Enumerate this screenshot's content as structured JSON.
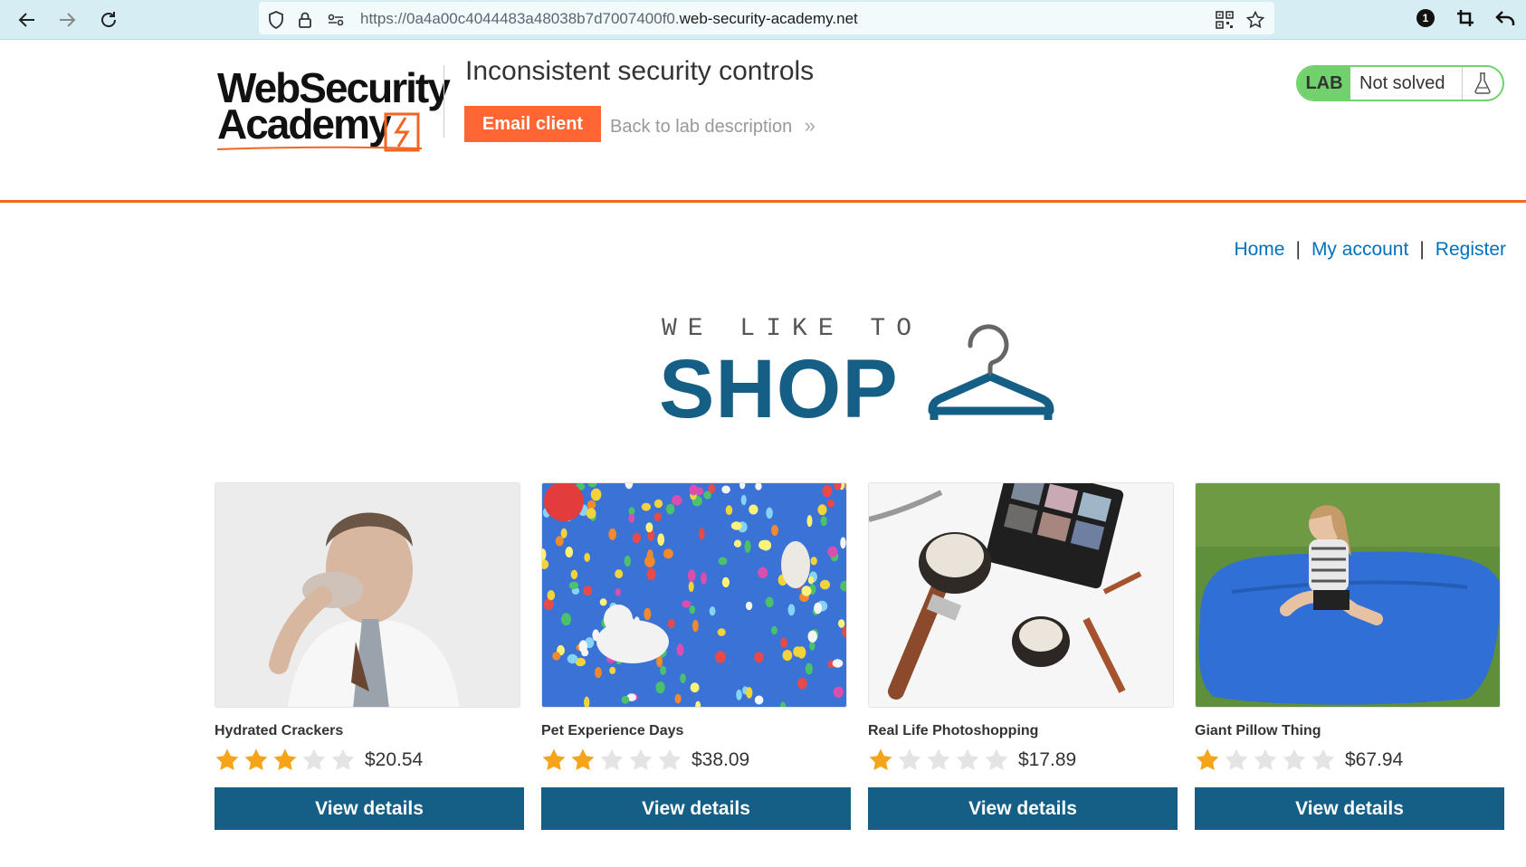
{
  "browser": {
    "url_prefix": "https://0a4a00c4044483a48038b7d7007400f0.",
    "url_domain": "web-security-academy.net",
    "badge_count": "1"
  },
  "lab": {
    "logo_line1": "WebSecurity",
    "logo_line2": "Academy",
    "title": "Inconsistent security controls",
    "email_client_label": "Email client",
    "back_link_label": "Back to lab description",
    "back_link_chevron": "»",
    "status_badge": "LAB",
    "status_text": "Not solved",
    "accent_color": "#f26622",
    "badge_color": "#70d16d"
  },
  "nav": {
    "home": "Home",
    "my_account": "My account",
    "register": "Register",
    "separator": "|"
  },
  "banner": {
    "small_text": "WE LIKE TO",
    "big_text": "SHOP",
    "brand_color": "#155f86"
  },
  "products": [
    {
      "name": "Hydrated Crackers",
      "rating": 3,
      "price": "$20.54",
      "button": "View details",
      "image": "man-eating-cracker"
    },
    {
      "name": "Pet Experience Days",
      "rating": 2,
      "price": "$38.09",
      "button": "View details",
      "image": "dogs-with-balloons"
    },
    {
      "name": "Real Life Photoshopping",
      "rating": 1,
      "price": "$17.89",
      "button": "View details",
      "image": "makeup-brushes-palette"
    },
    {
      "name": "Giant Pillow Thing",
      "rating": 1,
      "price": "$67.94",
      "button": "View details",
      "image": "girl-on-blue-pillow"
    }
  ]
}
